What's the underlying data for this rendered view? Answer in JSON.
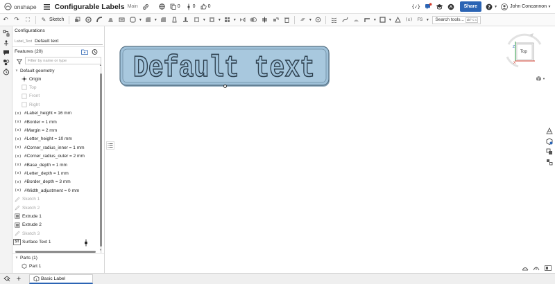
{
  "app": {
    "brand": "onshape",
    "doc_title": "Configurable Labels",
    "branch": "Main",
    "versions_count": "0",
    "branches_count": "0",
    "likes_count": "0",
    "share_label": "Share",
    "user_name": "John Concannon"
  },
  "toolbar": {
    "sketch_label": "Sketch",
    "search_placeholder": "Search tools...",
    "search_shortcut": "alt/⌥ c"
  },
  "panel": {
    "config_header": "Configurations",
    "config_param_label": "Label_Text",
    "config_param_value": "Default text",
    "features_header": "Features (20)",
    "filter_placeholder": "Filter by name or type",
    "default_geometry": "Default geometry",
    "features": [
      {
        "label": "Origin",
        "icon": "origin-icon",
        "dim": false,
        "indent": 2
      },
      {
        "label": "Top",
        "icon": "plane-icon",
        "dim": true,
        "indent": 2
      },
      {
        "label": "Front",
        "icon": "plane-icon",
        "dim": true,
        "indent": 2
      },
      {
        "label": "Right",
        "icon": "plane-icon",
        "dim": true,
        "indent": 2
      },
      {
        "label": "#Label_height = 16 mm",
        "icon": "variable-icon",
        "dim": false,
        "indent": 0
      },
      {
        "label": "#Border = 1 mm",
        "icon": "variable-icon",
        "dim": false,
        "indent": 0
      },
      {
        "label": "#Margin = 2 mm",
        "icon": "variable-icon",
        "dim": false,
        "indent": 0
      },
      {
        "label": "#Letter_height = 10 mm",
        "icon": "variable-icon",
        "dim": false,
        "indent": 0
      },
      {
        "label": "#Corner_radius_inner = 1 mm",
        "icon": "variable-icon",
        "dim": false,
        "indent": 0
      },
      {
        "label": "#Corner_radius_outer = 2 mm",
        "icon": "variable-icon",
        "dim": false,
        "indent": 0
      },
      {
        "label": "#Base_depth = 1 mm",
        "icon": "variable-icon",
        "dim": false,
        "indent": 0
      },
      {
        "label": "#Letter_depth = 1 mm",
        "icon": "variable-icon",
        "dim": false,
        "indent": 0
      },
      {
        "label": "#Border_depth = 3 mm",
        "icon": "variable-icon",
        "dim": false,
        "indent": 0
      },
      {
        "label": "#Width_adjustment = 0 mm",
        "icon": "variable-icon",
        "dim": false,
        "indent": 0
      },
      {
        "label": "Sketch 1",
        "icon": "sketch-icon",
        "dim": true,
        "indent": 0
      },
      {
        "label": "Sketch 2",
        "icon": "sketch-icon",
        "dim": true,
        "indent": 0
      },
      {
        "label": "Extrude 1",
        "icon": "extrude-icon",
        "dim": false,
        "indent": 0
      },
      {
        "label": "Extrude 2",
        "icon": "extrude-icon",
        "dim": false,
        "indent": 0
      },
      {
        "label": "Sketch 3",
        "icon": "sketch-icon",
        "dim": true,
        "indent": 0
      },
      {
        "label": "Surface Text 1",
        "icon": "surface-text-icon",
        "dim": false,
        "indent": 0
      }
    ],
    "parts_header": "Parts (1)",
    "parts": [
      {
        "label": "Part 1"
      }
    ]
  },
  "viewport": {
    "label_text": "Default text",
    "view_cube_face": "Top",
    "axis_z": "Z",
    "axis_x": "X",
    "label_fill": "#9fc1d9",
    "label_edge": "#5f7f96"
  },
  "bottom": {
    "tab_label": "Basic Label"
  },
  "colors": {
    "accent": "#2b64b4",
    "share_bg": "#2b64b4"
  }
}
